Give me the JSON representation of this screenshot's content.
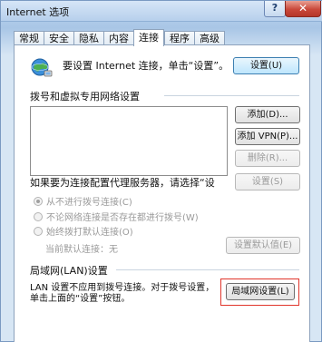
{
  "window": {
    "title": "Internet 选项",
    "help_label": "?",
    "close_label": "✕"
  },
  "tabs": [
    {
      "label": "常规",
      "active": false
    },
    {
      "label": "安全",
      "active": false
    },
    {
      "label": "隐私",
      "active": false
    },
    {
      "label": "内容",
      "active": false
    },
    {
      "label": "连接",
      "active": true
    },
    {
      "label": "程序",
      "active": false
    },
    {
      "label": "高级",
      "active": false
    }
  ],
  "setup": {
    "icon": "globe-network-icon",
    "text": "要设置 Internet 连接，单击“设置”。",
    "button_label": "设置(U)"
  },
  "dialup": {
    "group_label": "拨号和虚拟专用网络设置",
    "add_button": "添加(D)...",
    "add_vpn_button": "添加 VPN(P)...",
    "remove_button": "删除(R)...",
    "proxy_text": "如果要为连接配置代理服务器，请选择“设",
    "settings_button": "设置(S)",
    "options": [
      {
        "label": "从不进行拨号连接(C)",
        "checked": true
      },
      {
        "label": "不论网络连接是否存在都进行拨号(W)",
        "checked": false
      },
      {
        "label": "始终拨打默认连接(O)",
        "checked": false
      }
    ],
    "current_default": "当前默认连接：无",
    "set_default_button": "设置默认值(E)"
  },
  "lan": {
    "group_label": "局域网(LAN)设置",
    "text": "LAN 设置不应用到拨号连接。对于拨号设置，单击上面的“设置”按钮。",
    "button_label": "局域网设置(L)",
    "highlight_color": "#e0352b"
  }
}
